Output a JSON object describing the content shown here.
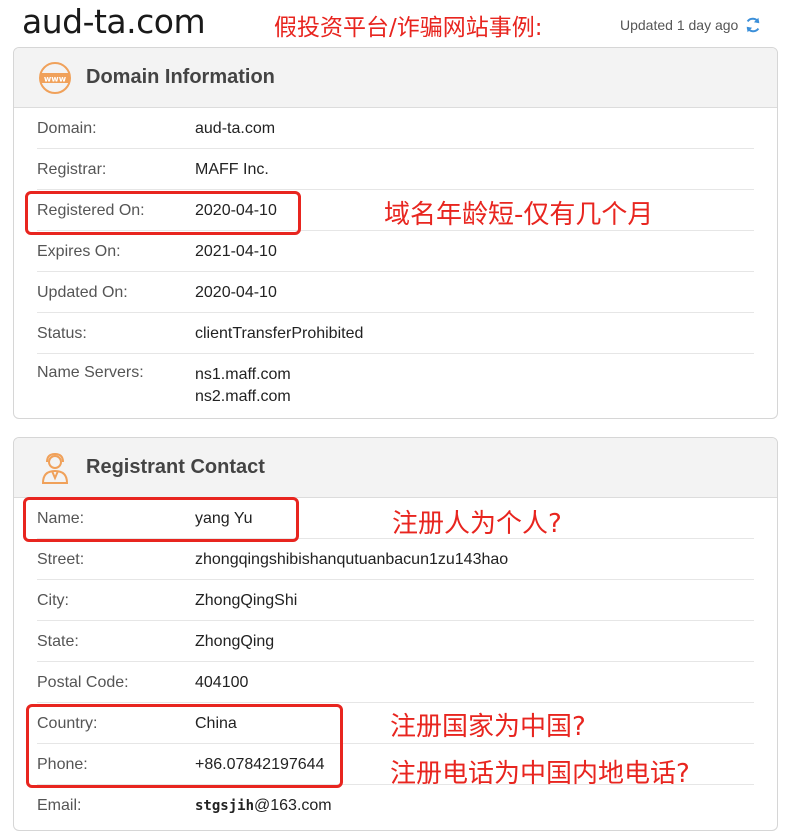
{
  "header": {
    "site": "aud-ta.com",
    "banner": "假投资平台/诈骗网站事例:",
    "updated": "Updated 1 day ago"
  },
  "domain_info": {
    "title": "Domain Information",
    "rows": [
      {
        "label": "Domain:",
        "value": "aud-ta.com"
      },
      {
        "label": "Registrar:",
        "value": "MAFF Inc."
      },
      {
        "label": "Registered On:",
        "value": "2020-04-10"
      },
      {
        "label": "Expires On:",
        "value": "2021-04-10"
      },
      {
        "label": "Updated On:",
        "value": "2020-04-10"
      },
      {
        "label": "Status:",
        "value": "clientTransferProhibited"
      }
    ],
    "name_servers": {
      "label": "Name Servers:",
      "values": [
        "ns1.maff.com",
        "ns2.maff.com"
      ]
    }
  },
  "registrant": {
    "title": "Registrant Contact",
    "rows": [
      {
        "label": "Name:",
        "value": "yang Yu"
      },
      {
        "label": "Street:",
        "value": "zhongqingshibishanqutuanbacun1zu143hao"
      },
      {
        "label": "City:",
        "value": "ZhongQingShi"
      },
      {
        "label": "State:",
        "value": "ZhongQing"
      },
      {
        "label": "Postal Code:",
        "value": "404100"
      },
      {
        "label": "Country:",
        "value": "China"
      },
      {
        "label": "Phone:",
        "value": "+86.07842197644"
      }
    ],
    "email": {
      "label": "Email:",
      "user": "stgsjih",
      "domain": "@163.com"
    }
  },
  "annotations": {
    "domain_age": "域名年龄短-仅有几个月",
    "individual": "注册人为个人?",
    "country": "注册国家为中国?",
    "phone": "注册电话为中国内地电话?"
  },
  "colors": {
    "annotation": "#e8251f",
    "header_bg": "#f3f3f3",
    "icon_orange": "#f0a15a"
  }
}
